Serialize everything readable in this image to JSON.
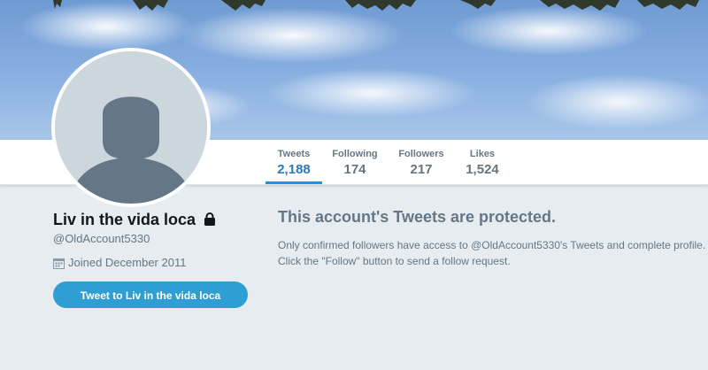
{
  "nav": {
    "items": [
      {
        "label": "Tweets",
        "value": "2,188"
      },
      {
        "label": "Following",
        "value": "174"
      },
      {
        "label": "Followers",
        "value": "217"
      },
      {
        "label": "Likes",
        "value": "1,524"
      }
    ],
    "active": "Tweets"
  },
  "profile": {
    "name": "Liv in the vida loca",
    "handle": "@OldAccount5330",
    "joined": "Joined December 2011",
    "tweet_button": "Tweet to Liv in the vida loca"
  },
  "protected": {
    "title": "This account's Tweets are protected.",
    "line1": "Only confirmed followers have access to @OldAccount5330's Tweets and complete profile.",
    "line2": "Click the \"Follow\" button to send a follow request."
  },
  "colors": {
    "accent": "#1b95e0",
    "button": "#2f9fd3",
    "background": "#e6ecf0"
  },
  "icons": [
    "lock-icon",
    "calendar-icon",
    "default-avatar-icon"
  ]
}
